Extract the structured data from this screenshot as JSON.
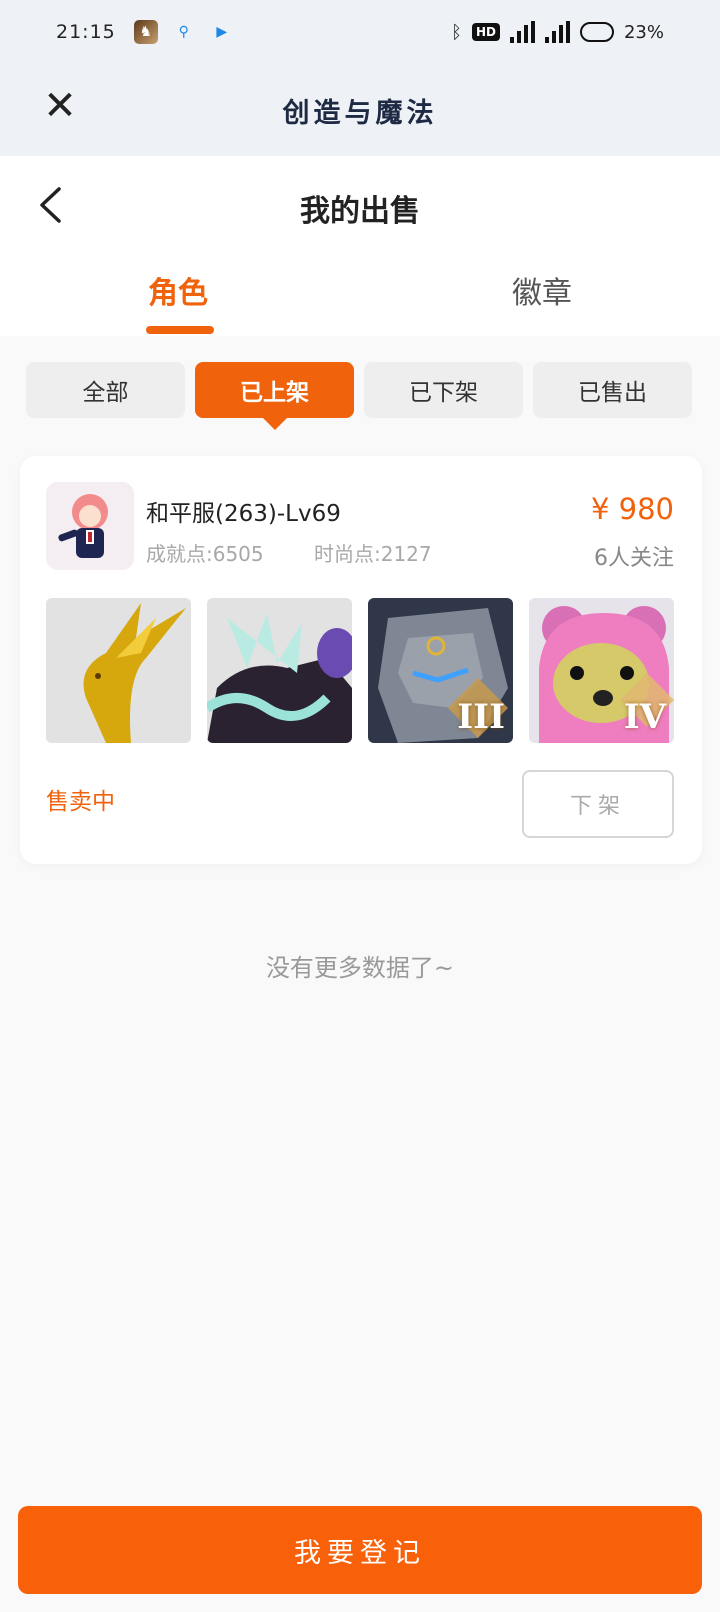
{
  "status_bar": {
    "time": "21:15",
    "hd": "HD",
    "battery": "23%",
    "notifications": [
      "game-app-icon",
      "search-app-icon",
      "play-app-icon"
    ]
  },
  "miniapp": {
    "title": "创造与魔法"
  },
  "page": {
    "title": "我的出售",
    "tabs": [
      {
        "label": "角色",
        "active": true
      },
      {
        "label": "徽章",
        "active": false
      }
    ]
  },
  "filters": [
    {
      "label": "全部",
      "active": false
    },
    {
      "label": "已上架",
      "active": true
    },
    {
      "label": "已下架",
      "active": false
    },
    {
      "label": "已售出",
      "active": false
    }
  ],
  "listing": {
    "server": "和平服(263)-Lv69",
    "achievement": "成就点:6505",
    "fashion": "时尚点:2127",
    "price": "¥ 980",
    "followers": "6人关注",
    "items": [
      {
        "name": "golden-dragon-mount",
        "tier": ""
      },
      {
        "name": "ice-dragon-mount",
        "tier": ""
      },
      {
        "name": "stone-golem-mount",
        "tier": "III"
      },
      {
        "name": "pink-bear-mount",
        "tier": "IV"
      }
    ],
    "status": "售卖中",
    "delist_label": "下架"
  },
  "footer": {
    "no_more": "没有更多数据了~",
    "register_label": "我要登记"
  },
  "colors": {
    "accent": "#f0620c",
    "header_bg": "#eef1f5",
    "page_bg": "#f9f9fa"
  }
}
